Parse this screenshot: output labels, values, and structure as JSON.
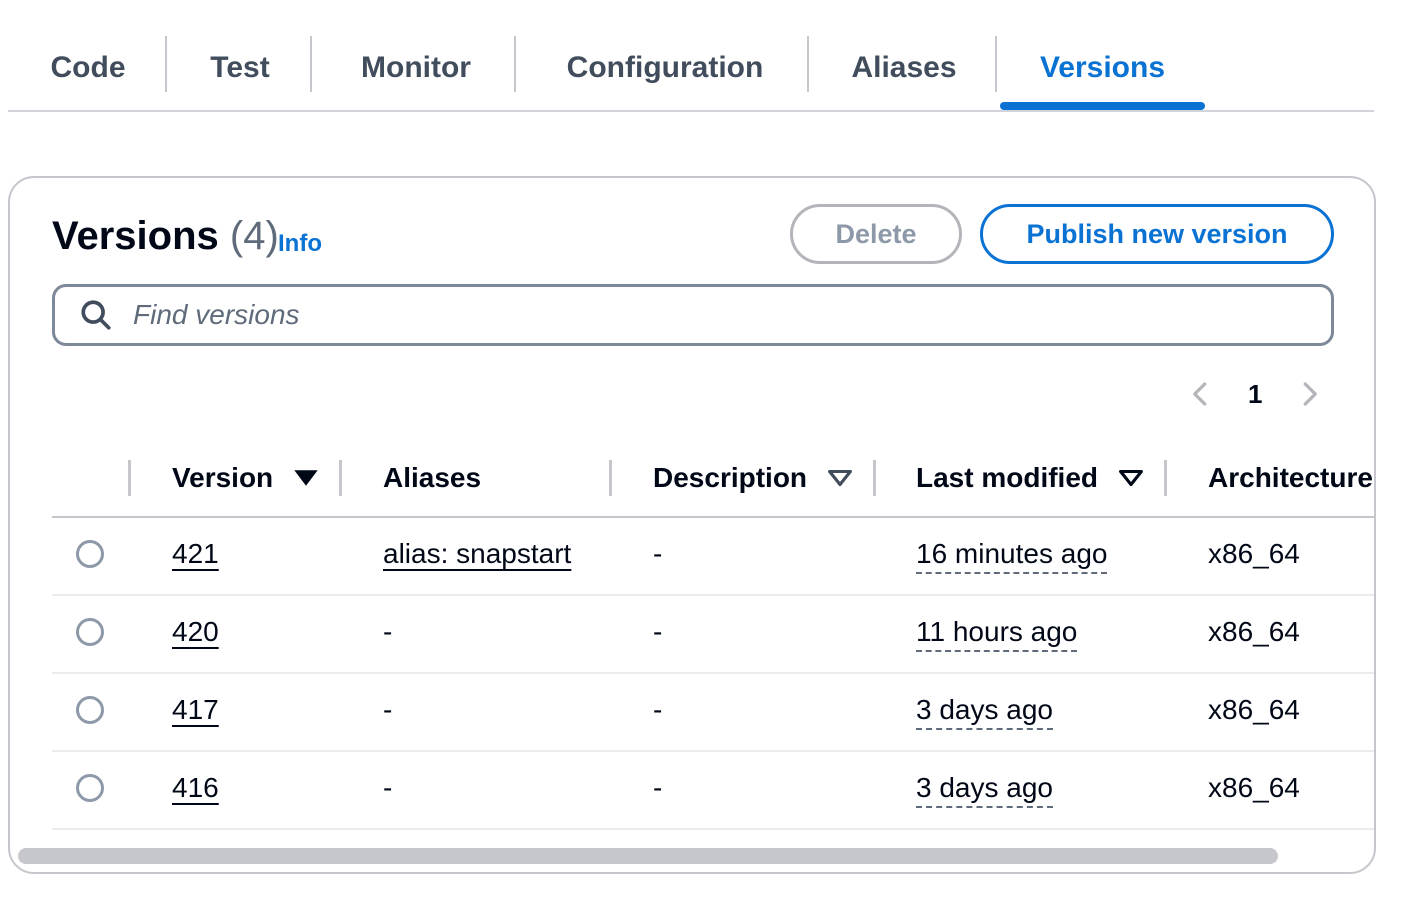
{
  "tabs": [
    {
      "label": "Code"
    },
    {
      "label": "Test"
    },
    {
      "label": "Monitor"
    },
    {
      "label": "Configuration"
    },
    {
      "label": "Aliases"
    },
    {
      "label": "Versions"
    }
  ],
  "panel": {
    "title": "Versions",
    "count": "(4)",
    "info_label": "Info",
    "delete_label": "Delete",
    "publish_label": "Publish new version",
    "search_placeholder": "Find versions",
    "current_page": "1"
  },
  "table": {
    "columns": [
      "Version",
      "Aliases",
      "Description",
      "Last modified",
      "Architecture"
    ],
    "rows": [
      {
        "version": "421",
        "alias": "alias: snapstart",
        "description": "-",
        "last_modified": "16 minutes ago",
        "architecture": "x86_64"
      },
      {
        "version": "420",
        "alias": "-",
        "description": "-",
        "last_modified": "11 hours ago",
        "architecture": "x86_64"
      },
      {
        "version": "417",
        "alias": "-",
        "description": "-",
        "last_modified": "3 days ago",
        "architecture": "x86_64"
      },
      {
        "version": "416",
        "alias": "-",
        "description": "-",
        "last_modified": "3 days ago",
        "architecture": "x86_64"
      }
    ]
  },
  "icons": {
    "search": "search-icon",
    "prev": "chevron-left-icon",
    "next": "chevron-right-icon",
    "sort_desc": "caret-down-filled-icon",
    "sort_none": "caret-down-outline-icon"
  },
  "colors": {
    "accent": "#0972d3",
    "text": "#000716",
    "border": "#c6c6cd"
  }
}
